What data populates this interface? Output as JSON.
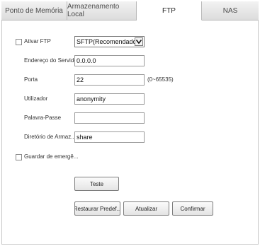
{
  "tabs": [
    {
      "label": "Ponto de Memória"
    },
    {
      "label": "Armazenamento Local"
    },
    {
      "label": "FTP"
    },
    {
      "label": "NAS"
    }
  ],
  "form": {
    "enable_ftp_label": "Ativar FTP",
    "protocol_value": "SFTP(Recomendado)",
    "server_label": "Endereço do Servidor",
    "server_value": "0.0.0.0",
    "port_label": "Porta",
    "port_value": "22",
    "port_hint": "(0~65535)",
    "user_label": "Utilizador",
    "user_value": "anonymity",
    "password_label": "Palavra-Passe",
    "password_value": "",
    "dir_label": "Diretório de Armaz....",
    "dir_value": "share",
    "emergency_label": "Guardar de emergê..."
  },
  "buttons": {
    "test": "Teste",
    "restore": "Restaurar Predef...",
    "refresh": "Atualizar",
    "confirm": "Confirmar"
  }
}
